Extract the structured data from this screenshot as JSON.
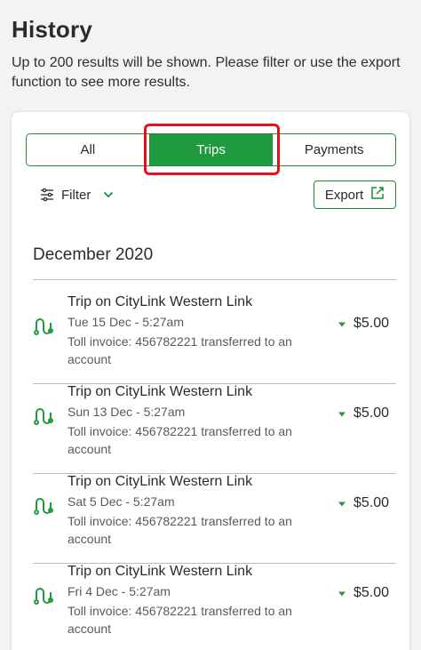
{
  "header": {
    "title": "History",
    "subtitle": "Up to 200 results will be shown. Please filter or use the export function to see more results."
  },
  "tabs": [
    {
      "label": "All",
      "active": false
    },
    {
      "label": "Trips",
      "active": true
    },
    {
      "label": "Payments",
      "active": false
    }
  ],
  "toolbar": {
    "filter_label": "Filter",
    "export_label": "Export"
  },
  "month": "December 2020",
  "transactions": [
    {
      "title": "Trip on CityLink Western Link",
      "date": "Tue 15 Dec - 5:27am",
      "description": "Toll invoice: 456782221 transferred to an account",
      "amount": "$5.00"
    },
    {
      "title": "Trip on CityLink Western Link",
      "date": "Sun 13 Dec - 5:27am",
      "description": "Toll invoice: 456782221 transferred to an account",
      "amount": "$5.00"
    },
    {
      "title": "Trip on CityLink Western Link",
      "date": "Sat 5 Dec - 5:27am",
      "description": "Toll invoice: 456782221 transferred to an account",
      "amount": "$5.00"
    },
    {
      "title": "Trip on CityLink Western Link",
      "date": "Fri 4 Dec - 5:27am",
      "description": "Toll invoice: 456782221 transferred to an account",
      "amount": "$5.00"
    }
  ],
  "colors": {
    "accent": "#1f9a3f",
    "highlight": "#e0121a",
    "background": "#f3f3f3"
  },
  "icons": {
    "filter": "sliders-icon",
    "export": "external-link-icon",
    "trip": "route-icon",
    "amount": "caret-down-icon"
  }
}
